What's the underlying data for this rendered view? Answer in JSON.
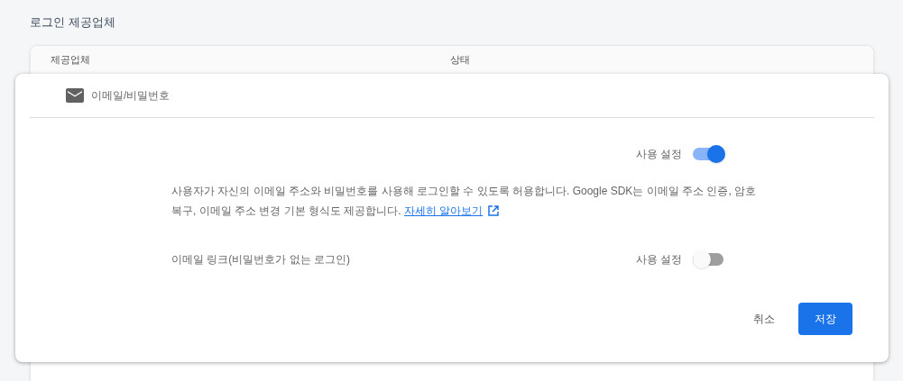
{
  "section_title": "로그인 제공업체",
  "table": {
    "columns": [
      "제공업체",
      "상태"
    ]
  },
  "dialog": {
    "provider": "이메일/비밀번호",
    "enable": {
      "label": "사용 설정",
      "on": true
    },
    "description": "사용자가 자신의 이메일 주소와 비밀번호를 사용해 로그인할 수 있도록 허용합니다. Google SDK는 이메일 주소 인증, 암호 복구, 이메일 주소 변경 기본 형식도 제공합니다.",
    "link": "자세히 알아보기",
    "email_link": {
      "label": "이메일 링크(비밀번호가 없는 로그인)",
      "toggle_label": "사용 설정",
      "on": false
    },
    "buttons": [
      {
        "label": "취소",
        "kind": "text"
      },
      {
        "label": "저장",
        "kind": "primary"
      }
    ]
  }
}
